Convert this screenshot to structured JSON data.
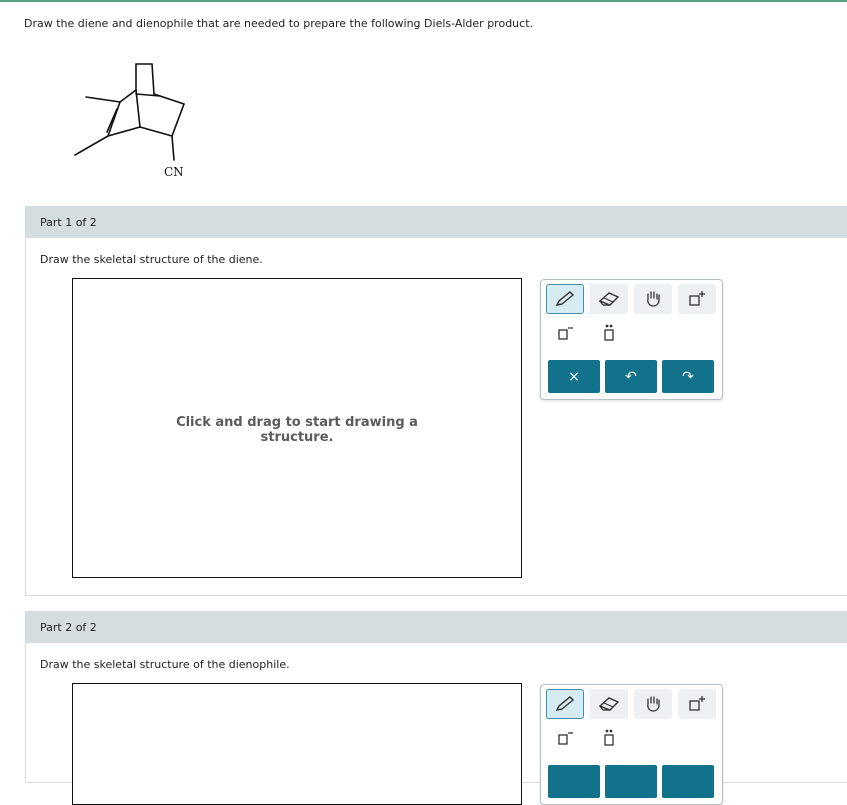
{
  "question": "Draw the diene and dienophile that are needed to prepare the following Diels-Alder product.",
  "molecule": {
    "substituent_label": "CN"
  },
  "parts": [
    {
      "header": "Part 1 of 2",
      "instruction": "Draw the skeletal structure of the diene.",
      "canvas_hint_line1": "Click and drag to start drawing a",
      "canvas_hint_line2": "structure."
    },
    {
      "header": "Part 2 of 2",
      "instruction": "Draw the skeletal structure of the dienophile."
    }
  ],
  "toolbox": {
    "tools": [
      "pencil-icon",
      "eraser-icon",
      "hand-icon",
      "add-template-icon",
      "charge-icon",
      "lone-pair-icon"
    ],
    "actions": [
      "clear-icon",
      "undo-icon",
      "redo-icon"
    ],
    "clear_glyph": "×",
    "undo_glyph": "↶",
    "redo_glyph": "↷"
  },
  "colors": {
    "accent": "#12728c",
    "header_bg": "#d6dde1",
    "top_bar": "#5aa386"
  }
}
